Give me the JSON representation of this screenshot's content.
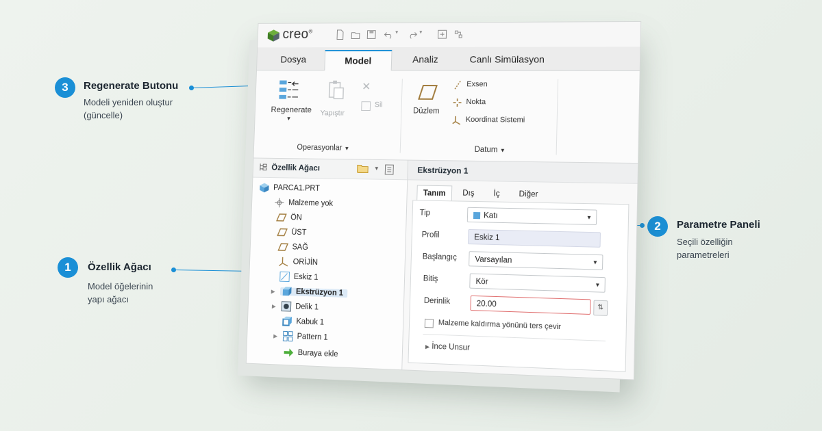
{
  "app": {
    "logo_text": "creo",
    "logo_mark": "®"
  },
  "tabs": [
    "Dosya",
    "Model",
    "Analiz",
    "Canlı Simülasyon"
  ],
  "ribbon": {
    "regenerate": "Regenerate",
    "paste": "Yapıştır",
    "delete": "Sil",
    "ops_group": "Operasyonlar",
    "plane": "Düzlem",
    "axis": "Exsen",
    "point": "Nokta",
    "coord": "Koordinat Sistemi",
    "datum_group": "Datum"
  },
  "tree": {
    "title": "Özellik Ağacı",
    "items": [
      "PARCA1.PRT",
      "Malzeme yok",
      "ÖN",
      "ÜST",
      "SAĞ",
      "ORİJİN",
      "Eskiz 1",
      "Ekstrüzyon 1",
      "Delik 1",
      "Kabuk 1",
      "Pattern 1",
      "Buraya ekle"
    ]
  },
  "param": {
    "title": "Ekstrüzyon 1",
    "tabs": [
      "Tanım",
      "Dış",
      "İç",
      "Diğer"
    ],
    "tip_label": "Tip",
    "tip_value": "Katı",
    "profil_label": "Profil",
    "profil_value": "Eskiz 1",
    "start_label": "Başlangıç",
    "start_value": "Varsayılan",
    "end_label": "Bitiş",
    "end_value": "Kör",
    "depth_label": "Derinlik",
    "depth_value": "20.00",
    "flip_label": "Malzeme kaldırma yönünü ters çevir",
    "thin_label": "İnce Unsur"
  },
  "callouts": [
    {
      "num": "1",
      "title": "Özellik Ağacı",
      "line1": "Model öğelerinin",
      "line2": "yapı ağacı"
    },
    {
      "num": "2",
      "title": "Parametre Paneli",
      "line1": "Seçili özelliğin",
      "line2": "parametreleri"
    },
    {
      "num": "3",
      "title": "Regenerate Butonu",
      "line1": "Modeli yeniden oluştur",
      "line2": "(güncelle)"
    }
  ],
  "colors": {
    "accent": "#1a8fd6",
    "error": "#e07070"
  }
}
